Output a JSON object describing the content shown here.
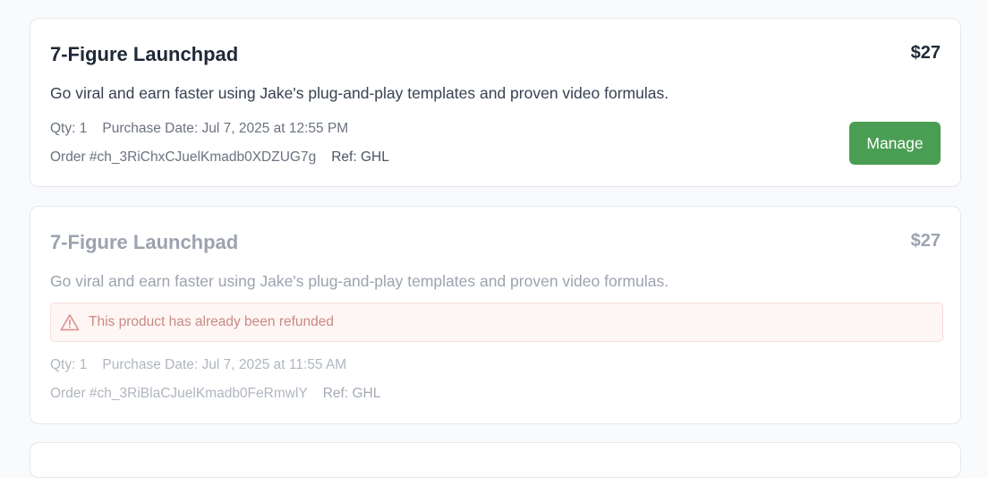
{
  "orders": [
    {
      "title": "7-Figure Launchpad",
      "price": "$27",
      "description": "Go viral and earn faster using Jake's plug-and-play templates and proven video formulas.",
      "qty": "Qty: 1",
      "purchase_date": "Purchase Date: Jul 7, 2025 at 12:55 PM",
      "order_number": "Order #ch_3RiChxCJuelKmadb0XDZUG7g",
      "ref": "Ref: GHL",
      "manage_label": "Manage"
    },
    {
      "title": "7-Figure Launchpad",
      "price": "$27",
      "description": "Go viral and earn faster using Jake's plug-and-play templates and proven video formulas.",
      "refund_notice": "This product has already been refunded",
      "qty": "Qty: 1",
      "purchase_date": "Purchase Date: Jul 7, 2025 at 11:55 AM",
      "order_number": "Order #ch_3RiBlaCJuelKmadb0FeRmwlY",
      "ref": "Ref: GHL"
    }
  ],
  "colors": {
    "manage_button": "#4a9e53",
    "refund_alert_bg": "#fef6f5",
    "refund_alert_text": "#c98a85"
  },
  "icons": {
    "refund_alert": "warning-triangle-icon"
  }
}
